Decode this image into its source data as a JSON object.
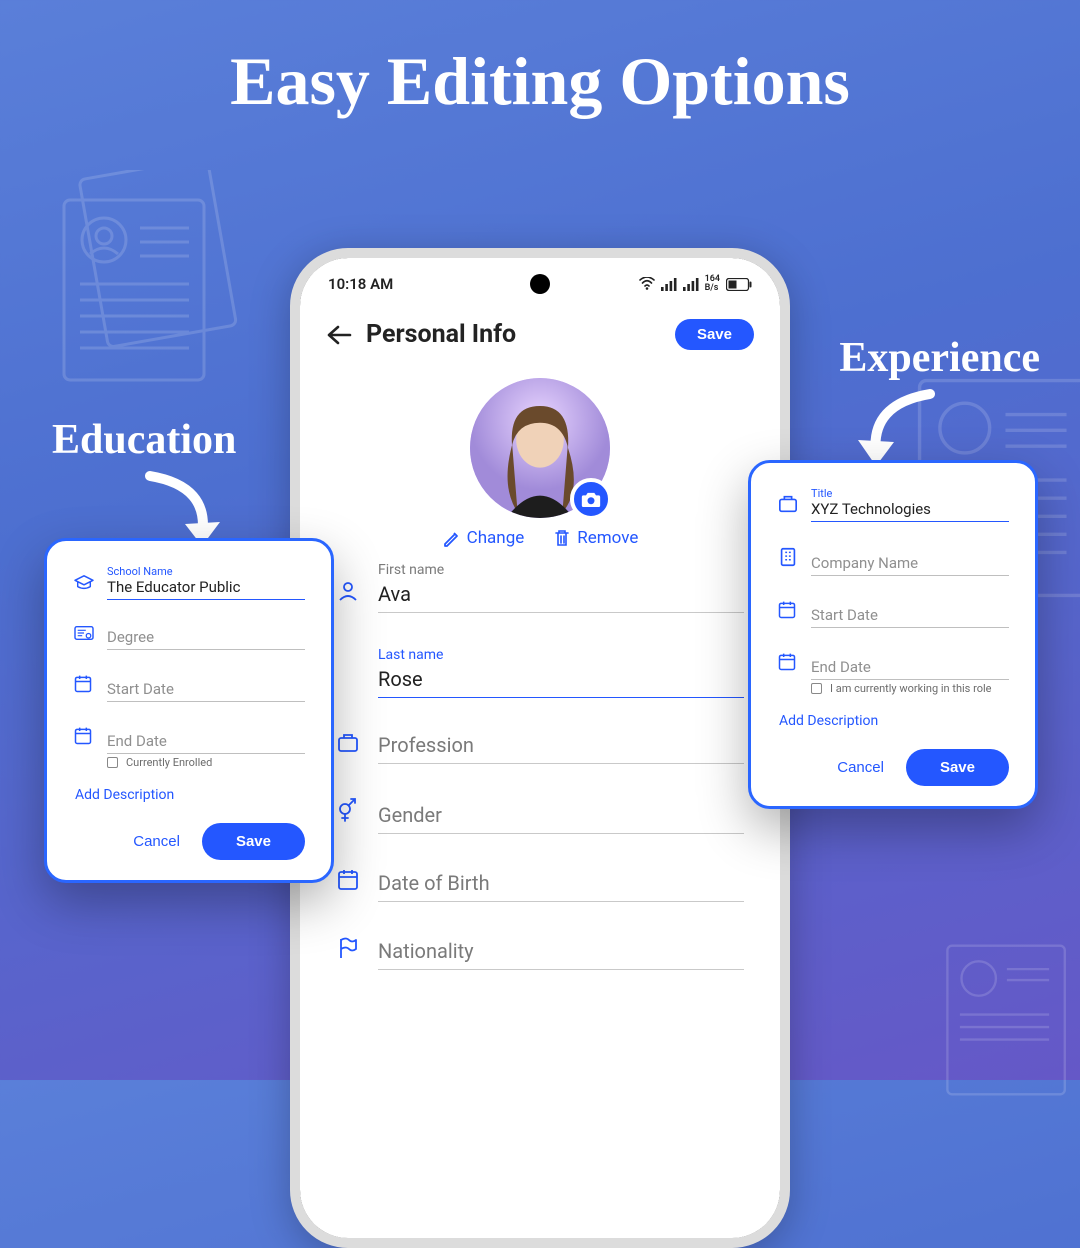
{
  "headline": "Easy Editing Options",
  "callouts": {
    "education": "Education",
    "experience": "Experience"
  },
  "phone": {
    "status": {
      "time": "10:18 AM",
      "net_rate": "164",
      "net_unit": "B/s"
    },
    "appbar": {
      "title": "Personal Info",
      "save": "Save"
    },
    "photo_actions": {
      "change": "Change",
      "remove": "Remove"
    },
    "fields": {
      "first_name": {
        "label": "First name",
        "value": "Ava"
      },
      "last_name": {
        "label": "Last name",
        "value": "Rose"
      },
      "profession": {
        "label": "Profession",
        "value": ""
      },
      "gender": {
        "label": "Gender",
        "value": ""
      },
      "dob": {
        "label": "Date of Birth",
        "value": ""
      },
      "nationality": {
        "label": "Nationality",
        "value": ""
      }
    }
  },
  "education_card": {
    "school": {
      "label": "School Name",
      "value": "The Educator Public"
    },
    "degree": {
      "label": "Degree",
      "value": ""
    },
    "start": {
      "label": "Start Date",
      "value": ""
    },
    "end": {
      "label": "End Date",
      "value": ""
    },
    "enrolled": "Currently Enrolled",
    "add_desc": "Add Description",
    "cancel": "Cancel",
    "save": "Save"
  },
  "experience_card": {
    "title": {
      "label": "Title",
      "value": "XYZ Technologies"
    },
    "company": {
      "label": "Company Name",
      "value": ""
    },
    "start": {
      "label": "Start Date",
      "value": ""
    },
    "end": {
      "label": "End Date",
      "value": ""
    },
    "working": "I am currently working in this role",
    "add_desc": "Add Description",
    "cancel": "Cancel",
    "save": "Save"
  }
}
